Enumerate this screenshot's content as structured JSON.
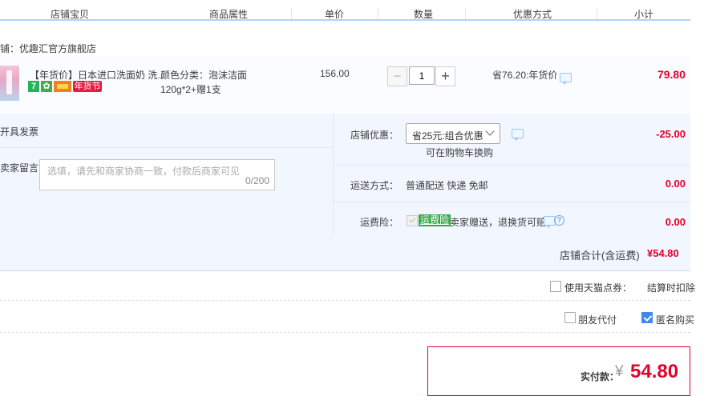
{
  "header": {
    "col_shop_item": "店铺宝贝",
    "col_attributes": "商品属性",
    "col_unit_price": "单价",
    "col_quantity": "数量",
    "col_discount": "优惠方式",
    "col_subtotal": "小计"
  },
  "shop": {
    "name": "铺：优趣汇官方旗舰店"
  },
  "item": {
    "title": "【年货价】日本进口洗面奶 洗...",
    "badge_new_year": "年货节",
    "badge_7": "7",
    "attributes": "颜色分类：泡沫洁面120g*2+赠1支",
    "unit_price": "156.00",
    "quantity": "1",
    "qty_minus": "−",
    "qty_plus": "+",
    "discount_text": "省76.20:年货价",
    "subtotal": "79.80"
  },
  "options": {
    "invoice_label": "开具发票",
    "message_label": "卖家留言：",
    "message_placeholder": "选填，请先和商家协商一致，付款后商家可见",
    "message_counter": "0/200",
    "shop_discount_label": "店铺优惠：",
    "shop_discount_selected": "省25元:组合优惠",
    "shop_discount_note": "可在购物车换购",
    "shop_discount_amount": "-25.00",
    "shipping_label": "运送方式：",
    "shipping_value": "普通配送 快递 免邮",
    "shipping_amount": "0.00",
    "insurance_label": "运费险：",
    "insurance_tag": "运费险",
    "insurance_text": "卖家赠送，退换货可赔",
    "insurance_amount": "0.00"
  },
  "totals": {
    "shop_total_label": "店铺合计(含运费)",
    "shop_total_value": "¥54.80",
    "tmall_points_label": "使用天猫点券：",
    "tmall_points_note": "结算时扣除",
    "friend_pay_label": "朋友代付",
    "anonymous_label": "匿名购买",
    "actual_pay_label": "实付款：",
    "currency": "¥",
    "actual_pay_value": "54.80"
  },
  "colors": {
    "accent_red": "#e4002b",
    "header_border": "#b2d1ff",
    "panel_bg": "#f2f7ff",
    "checkbox_blue": "#3d8aeb"
  }
}
